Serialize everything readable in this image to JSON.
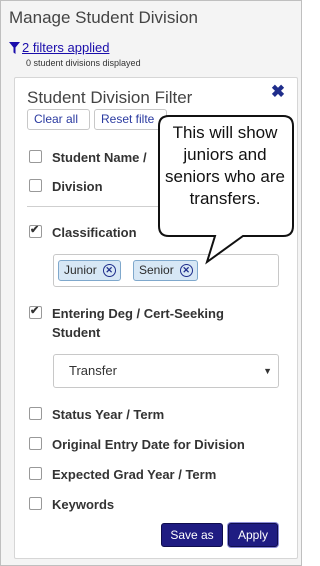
{
  "header": {
    "title": "Manage Student Division",
    "filters_link": "2 filters applied",
    "count_text": "0 student divisions displayed"
  },
  "panel": {
    "title": "Student Division Filter",
    "close_icon": "close-x-icon",
    "clear_all": "Clear all",
    "reset": "Reset filte"
  },
  "filters": [
    {
      "label": "Student Name /",
      "checked": false
    },
    {
      "label": "Division",
      "checked": false
    },
    {
      "label": "Classification",
      "checked": true
    },
    {
      "label": "Entering Deg / Cert-Seeking Student",
      "checked": true
    },
    {
      "label": "Status Year / Term",
      "checked": false
    },
    {
      "label": "Original Entry Date for Division",
      "checked": false
    },
    {
      "label": "Expected Grad Year / Term",
      "checked": false
    },
    {
      "label": "Keywords",
      "checked": false
    }
  ],
  "classification_tags": [
    "Junior",
    "Senior"
  ],
  "entering_select": {
    "value": "Transfer"
  },
  "buttons": {
    "save_as": "Save as",
    "apply": "Apply"
  },
  "callout": {
    "text": "This will show juniors and seniors who are transfers."
  },
  "colors": {
    "accent": "#1f1c82",
    "link": "#1a0dab",
    "tag_bg": "#d7e7f5"
  }
}
